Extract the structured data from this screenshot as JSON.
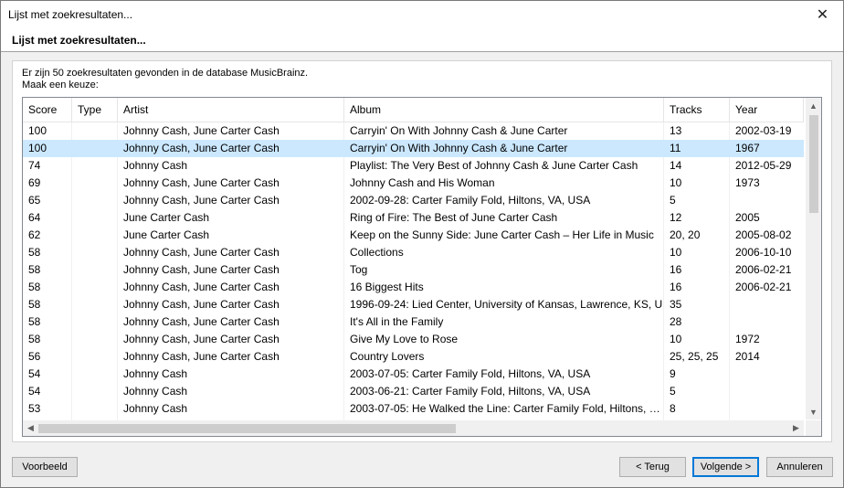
{
  "window": {
    "title": "Lijst met zoekresultaten...",
    "close_glyph": "✕"
  },
  "header": {
    "title": "Lijst met zoekresultaten..."
  },
  "info": {
    "line1": "Er zijn 50 zoekresultaten gevonden in de database MusicBrainz.",
    "line2": "Maak een keuze:"
  },
  "table": {
    "columns": [
      "Score",
      "Type",
      "Artist",
      "Album",
      "Tracks",
      "Year"
    ],
    "selected_row": 1,
    "rows": [
      [
        "100",
        "",
        "Johnny Cash, June Carter Cash",
        "Carryin' On With Johnny Cash & June Carter",
        "13",
        "2002-03-19"
      ],
      [
        "100",
        "",
        "Johnny Cash, June Carter Cash",
        "Carryin' On With Johnny Cash & June Carter",
        "11",
        "1967"
      ],
      [
        "74",
        "",
        "Johnny Cash",
        "Playlist: The Very Best of Johnny Cash & June Carter Cash",
        "14",
        "2012-05-29"
      ],
      [
        "69",
        "",
        "Johnny Cash, June Carter Cash",
        "Johnny Cash and His Woman",
        "10",
        "1973"
      ],
      [
        "65",
        "",
        "Johnny Cash, June Carter Cash",
        "2002-09-28: Carter Family Fold, Hiltons, VA, USA",
        "5",
        ""
      ],
      [
        "64",
        "",
        "June Carter Cash",
        "Ring of Fire: The Best of June Carter Cash",
        "12",
        "2005"
      ],
      [
        "62",
        "",
        "June Carter Cash",
        "Keep on the Sunny Side: June Carter Cash – Her Life in Music",
        "20, 20",
        "2005-08-02"
      ],
      [
        "58",
        "",
        "Johnny Cash, June Carter Cash",
        "Collections",
        "10",
        "2006-10-10"
      ],
      [
        "58",
        "",
        "Johnny Cash, June Carter Cash",
        "Tog",
        "16",
        "2006-02-21"
      ],
      [
        "58",
        "",
        "Johnny Cash, June Carter Cash",
        "16 Biggest Hits",
        "16",
        "2006-02-21"
      ],
      [
        "58",
        "",
        "Johnny Cash, June Carter Cash",
        "1996-09-24: Lied Center, University of Kansas, Lawrence, KS, U",
        "35",
        ""
      ],
      [
        "58",
        "",
        "Johnny Cash, June Carter Cash",
        "It's All in the Family",
        "28",
        ""
      ],
      [
        "58",
        "",
        "Johnny Cash, June Carter Cash",
        "Give My Love to Rose",
        "10",
        "1972"
      ],
      [
        "56",
        "",
        "Johnny Cash, June Carter Cash",
        "Country Lovers",
        "25, 25, 25",
        "2014"
      ],
      [
        "54",
        "",
        "Johnny Cash",
        "2003-07-05: Carter Family Fold, Hiltons, VA, USA",
        "9",
        ""
      ],
      [
        "54",
        "",
        "Johnny Cash",
        "2003-06-21: Carter Family Fold, Hiltons, VA, USA",
        "5",
        ""
      ],
      [
        "53",
        "",
        "Johnny Cash",
        "2003-07-05: He Walked the Line: Carter Family Fold, Hiltons, V...",
        "8",
        ""
      ]
    ]
  },
  "scroll": {
    "up": "▲",
    "down": "▼",
    "left": "◀",
    "right": "▶"
  },
  "buttons": {
    "preview": "Voorbeeld",
    "back": "< Terug",
    "next": "Volgende >",
    "cancel": "Annuleren"
  }
}
